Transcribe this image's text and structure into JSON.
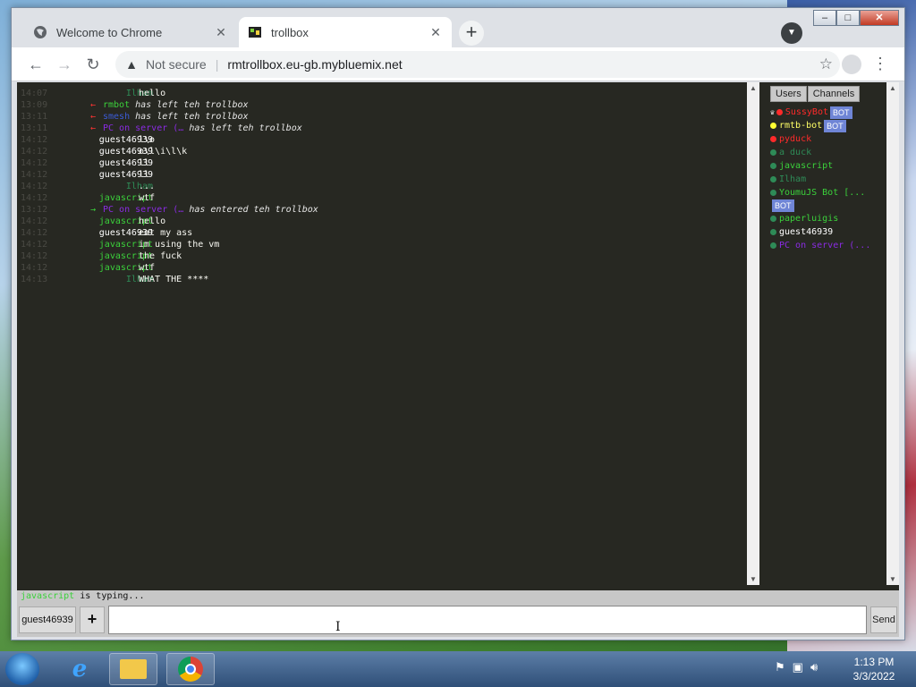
{
  "browser": {
    "tabs": [
      {
        "title": "Welcome to Chrome",
        "active": false
      },
      {
        "title": "trollbox",
        "active": true
      }
    ],
    "new_tab_symbol": "+",
    "security_label": "Not secure",
    "url": "rmtrollbox.eu-gb.mybluemix.net"
  },
  "chat": {
    "messages": [
      {
        "time": "14:07",
        "nick": "Ilham",
        "nick_color": "#2e8b57",
        "text": "hello",
        "system": false
      },
      {
        "time": "13:09",
        "nick": "rmbot",
        "nick_color": "#3bd13b",
        "text": "has left teh trollbox",
        "system": true,
        "marker": "←"
      },
      {
        "time": "13:11",
        "nick": "smesh",
        "nick_color": "#3b5bd6",
        "text": "has left teh trollbox",
        "system": true,
        "marker": "←"
      },
      {
        "time": "13:11",
        "nick": "PC on server (…",
        "nick_color": "#8a2be2",
        "text": "has left teh trollbox",
        "system": true,
        "marker": "←"
      },
      {
        "time": "14:12",
        "nick": "guest46939",
        "nick_color": "#ffffff",
        "text": "l\\o",
        "system": false
      },
      {
        "time": "14:12",
        "nick": "guest46939",
        "nick_color": "#ffffff",
        "text": "o\\l\\i\\l\\k",
        "system": false
      },
      {
        "time": "14:12",
        "nick": "guest46939",
        "nick_color": "#ffffff",
        "text": "ll",
        "system": false
      },
      {
        "time": "14:12",
        "nick": "guest46939",
        "nick_color": "#ffffff",
        "text": "ll",
        "system": false
      },
      {
        "time": "14:12",
        "nick": "Ilham",
        "nick_color": "#2e8b57",
        "text": "...",
        "system": false
      },
      {
        "time": "14:12",
        "nick": "javascript",
        "nick_color": "#3bd13b",
        "text": "wtf",
        "system": false
      },
      {
        "time": "13:12",
        "nick": "PC on server (…",
        "nick_color": "#8a2be2",
        "text": "has entered teh trollbox",
        "system": true,
        "marker": "→"
      },
      {
        "time": "14:12",
        "nick": "javascript",
        "nick_color": "#3bd13b",
        "text": "hello",
        "system": false
      },
      {
        "time": "14:12",
        "nick": "guest46939",
        "nick_color": "#ffffff",
        "text": "eat my ass",
        "system": false
      },
      {
        "time": "14:12",
        "nick": "javascript",
        "nick_color": "#3bd13b",
        "text": "im using the vm",
        "system": false
      },
      {
        "time": "14:12",
        "nick": "javascript",
        "nick_color": "#3bd13b",
        "text": "the fuck",
        "system": false
      },
      {
        "time": "14:12",
        "nick": "javascript",
        "nick_color": "#3bd13b",
        "text": "wtf",
        "system": false
      },
      {
        "time": "14:13",
        "nick": "Ilham",
        "nick_color": "#2e8b57",
        "text": "WHAT THE ****",
        "system": false
      }
    ],
    "typing_user": "javascript",
    "typing_suffix": "is typing..."
  },
  "sidebar": {
    "tabs": [
      "Users",
      "Channels"
    ],
    "users": [
      {
        "name": "SussyBot",
        "color": "#ff2a2a",
        "dot": "#ff2a2a",
        "bot": true,
        "prefix": "♛"
      },
      {
        "name": "rmtb-bot",
        "color": "#ffff66",
        "dot": "#ffff33",
        "bot": true
      },
      {
        "name": "pyduck",
        "color": "#ff2a2a",
        "dot": "#ff2a2a",
        "bot": false
      },
      {
        "name": "a duck",
        "color": "#2e8b57",
        "dot": "#2e8b57",
        "bot": false
      },
      {
        "name": "javascript",
        "color": "#3bd13b",
        "dot": "#2e8b57",
        "bot": false
      },
      {
        "name": "Ilham",
        "color": "#2e8b57",
        "dot": "#2e8b57",
        "bot": false
      },
      {
        "name": "YoumuJS Bot [...",
        "color": "#3bd13b",
        "dot": "#2e8b57",
        "bot": true
      },
      {
        "name": "paperluigis",
        "color": "#3bd13b",
        "dot": "#2e8b57",
        "bot": false
      },
      {
        "name": "guest46939",
        "color": "#ffffff",
        "dot": "#2e8b57",
        "bot": false
      },
      {
        "name": "PC on server (...",
        "color": "#8a2be2",
        "dot": "#2e8b57",
        "bot": false
      }
    ],
    "bot_label": "BOT"
  },
  "input": {
    "nick": "guest46939",
    "plus_label": "+",
    "send_label": "Send",
    "value": ""
  },
  "taskbar": {
    "time": "1:13 PM",
    "date": "3/3/2022"
  },
  "colors": {
    "chat_bg": "#272822",
    "timestamp": "#4a4a44"
  }
}
